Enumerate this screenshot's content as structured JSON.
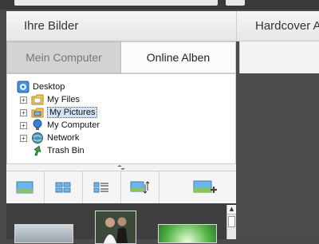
{
  "header": {
    "left_title": "Ihre Bilder",
    "right_title": "Hardcover A"
  },
  "tabs": [
    {
      "label": "Mein Computer",
      "active": true
    },
    {
      "label": "Online Alben",
      "active": false
    }
  ],
  "tree": {
    "root": {
      "label": "Desktop",
      "icon": "desktop-icon"
    },
    "items": [
      {
        "label": "My Files",
        "icon": "folder-icon",
        "expandable": true,
        "selected": false
      },
      {
        "label": "My Pictures",
        "icon": "pictures-folder-icon",
        "expandable": true,
        "selected": true
      },
      {
        "label": "My Computer",
        "icon": "computer-icon",
        "expandable": true,
        "selected": false
      },
      {
        "label": "Network",
        "icon": "network-icon",
        "expandable": true,
        "selected": false
      },
      {
        "label": "Trash Bin",
        "icon": "recycle-bin-icon",
        "expandable": false,
        "selected": false
      }
    ]
  },
  "toolbar": {
    "buttons": [
      "large-thumbnail-view-icon",
      "grid-view-icon",
      "list-view-icon",
      "sort-order-icon",
      "add-images-icon"
    ]
  },
  "colors": {
    "selection": "#d4e4f6",
    "panel": "#f3f3f3",
    "dark_background": "#4a4a4a"
  }
}
